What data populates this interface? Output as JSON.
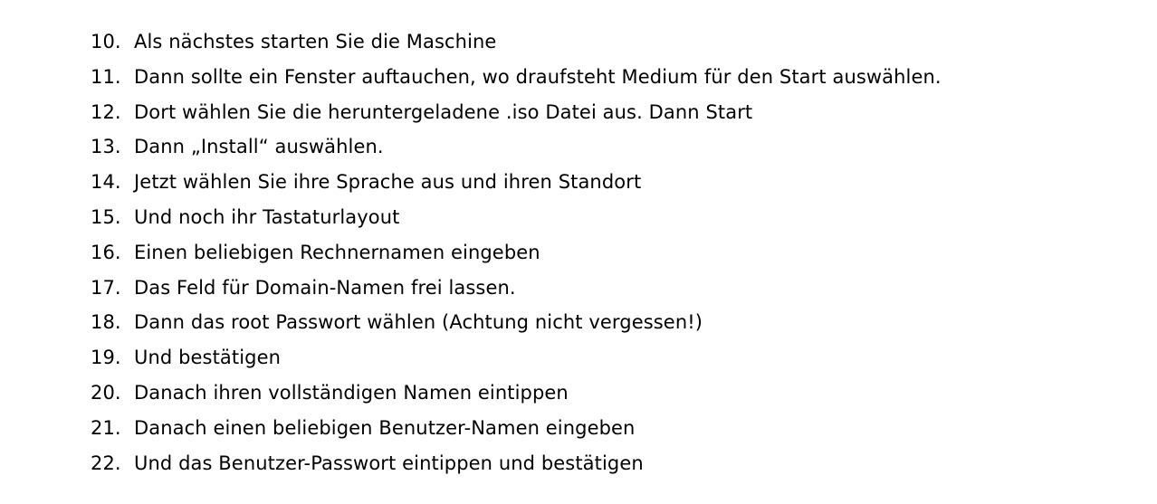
{
  "document": {
    "items": [
      {
        "number": "10.",
        "text": "Als nächstes starten Sie die Maschine"
      },
      {
        "number": "11.",
        "text": "Dann sollte ein Fenster auftauchen, wo draufsteht Medium für den Start auswählen."
      },
      {
        "number": "12.",
        "text": "Dort wählen Sie die heruntergeladene .iso Datei aus. Dann Start"
      },
      {
        "number": "13.",
        "text": "Dann „Install“ auswählen."
      },
      {
        "number": "14.",
        "text": "Jetzt wählen Sie ihre Sprache aus und ihren Standort"
      },
      {
        "number": "15.",
        "text": "Und noch ihr Tastaturlayout"
      },
      {
        "number": "16.",
        "text": "Einen beliebigen Rechnernamen eingeben"
      },
      {
        "number": "17.",
        "text": "Das Feld für Domain-Namen frei lassen."
      },
      {
        "number": "18.",
        "text": "Dann das root Passwort wählen (Achtung nicht vergessen!)"
      },
      {
        "number": "19.",
        "text": "Und bestätigen"
      },
      {
        "number": "20.",
        "text": "Danach ihren vollständigen Namen eintippen"
      },
      {
        "number": "21.",
        "text": "Danach einen beliebigen Benutzer-Namen eingeben"
      },
      {
        "number": "22.",
        "text": "Und das Benutzer-Passwort eintippen und bestätigen"
      }
    ]
  }
}
